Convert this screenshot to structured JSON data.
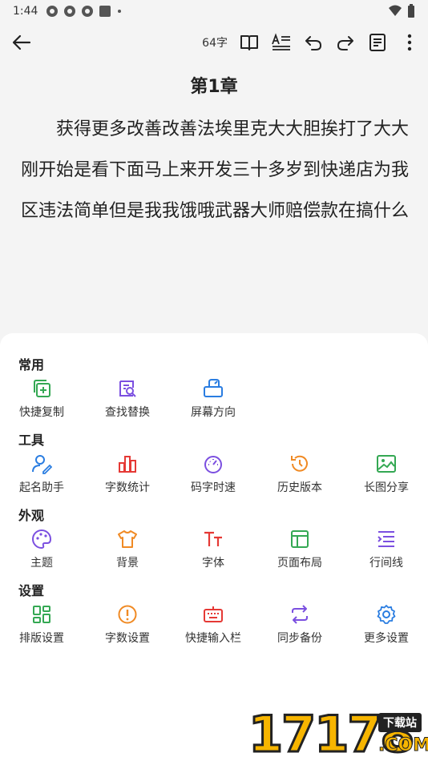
{
  "status_bar": {
    "time": "1:44"
  },
  "toolbar": {
    "word_count": "64字"
  },
  "chapter": {
    "title": "第1章",
    "body": "获得更多改善改善法埃里克大大胆挨打了大大刚开始是看下面马上来开发三十多岁到快递店为我区违法简单但是我我饿哦武器大师赔偿款在搞什么"
  },
  "sheet": {
    "sections": [
      {
        "title": "常用",
        "items": [
          {
            "label": "快捷复制",
            "icon": "copy-plus-icon",
            "color": "#34a853"
          },
          {
            "label": "查找替换",
            "icon": "find-replace-icon",
            "color": "#7b4fe0"
          },
          {
            "label": "屏幕方向",
            "icon": "screen-rotate-icon",
            "color": "#2a7de1"
          }
        ]
      },
      {
        "title": "工具",
        "items": [
          {
            "label": "起名助手",
            "icon": "user-edit-icon",
            "color": "#2a7de1"
          },
          {
            "label": "字数统计",
            "icon": "bar-chart-icon",
            "color": "#e53935"
          },
          {
            "label": "码字时速",
            "icon": "speedometer-icon",
            "color": "#7b4fe0"
          },
          {
            "label": "历史版本",
            "icon": "history-icon",
            "color": "#f08a24"
          },
          {
            "label": "长图分享",
            "icon": "image-icon",
            "color": "#34a853"
          }
        ]
      },
      {
        "title": "外观",
        "items": [
          {
            "label": "主题",
            "icon": "palette-icon",
            "color": "#7b4fe0"
          },
          {
            "label": "背景",
            "icon": "shirt-icon",
            "color": "#f08a24"
          },
          {
            "label": "字体",
            "icon": "font-icon",
            "color": "#e53935"
          },
          {
            "label": "页面布局",
            "icon": "layout-icon",
            "color": "#34a853"
          },
          {
            "label": "行间线",
            "icon": "line-spacing-icon",
            "color": "#7b4fe0"
          }
        ]
      },
      {
        "title": "设置",
        "items": [
          {
            "label": "排版设置",
            "icon": "grid-icon",
            "color": "#34a853"
          },
          {
            "label": "字数设置",
            "icon": "alert-circle-icon",
            "color": "#f08a24"
          },
          {
            "label": "快捷输入栏",
            "icon": "keyboard-icon",
            "color": "#e53935"
          },
          {
            "label": "同步备份",
            "icon": "sync-icon",
            "color": "#7b4fe0"
          },
          {
            "label": "更多设置",
            "icon": "gear-icon",
            "color": "#2a7de1"
          }
        ]
      }
    ]
  },
  "watermark": {
    "number": "17178",
    "badge": "下载站",
    "suffix": ".COM"
  }
}
